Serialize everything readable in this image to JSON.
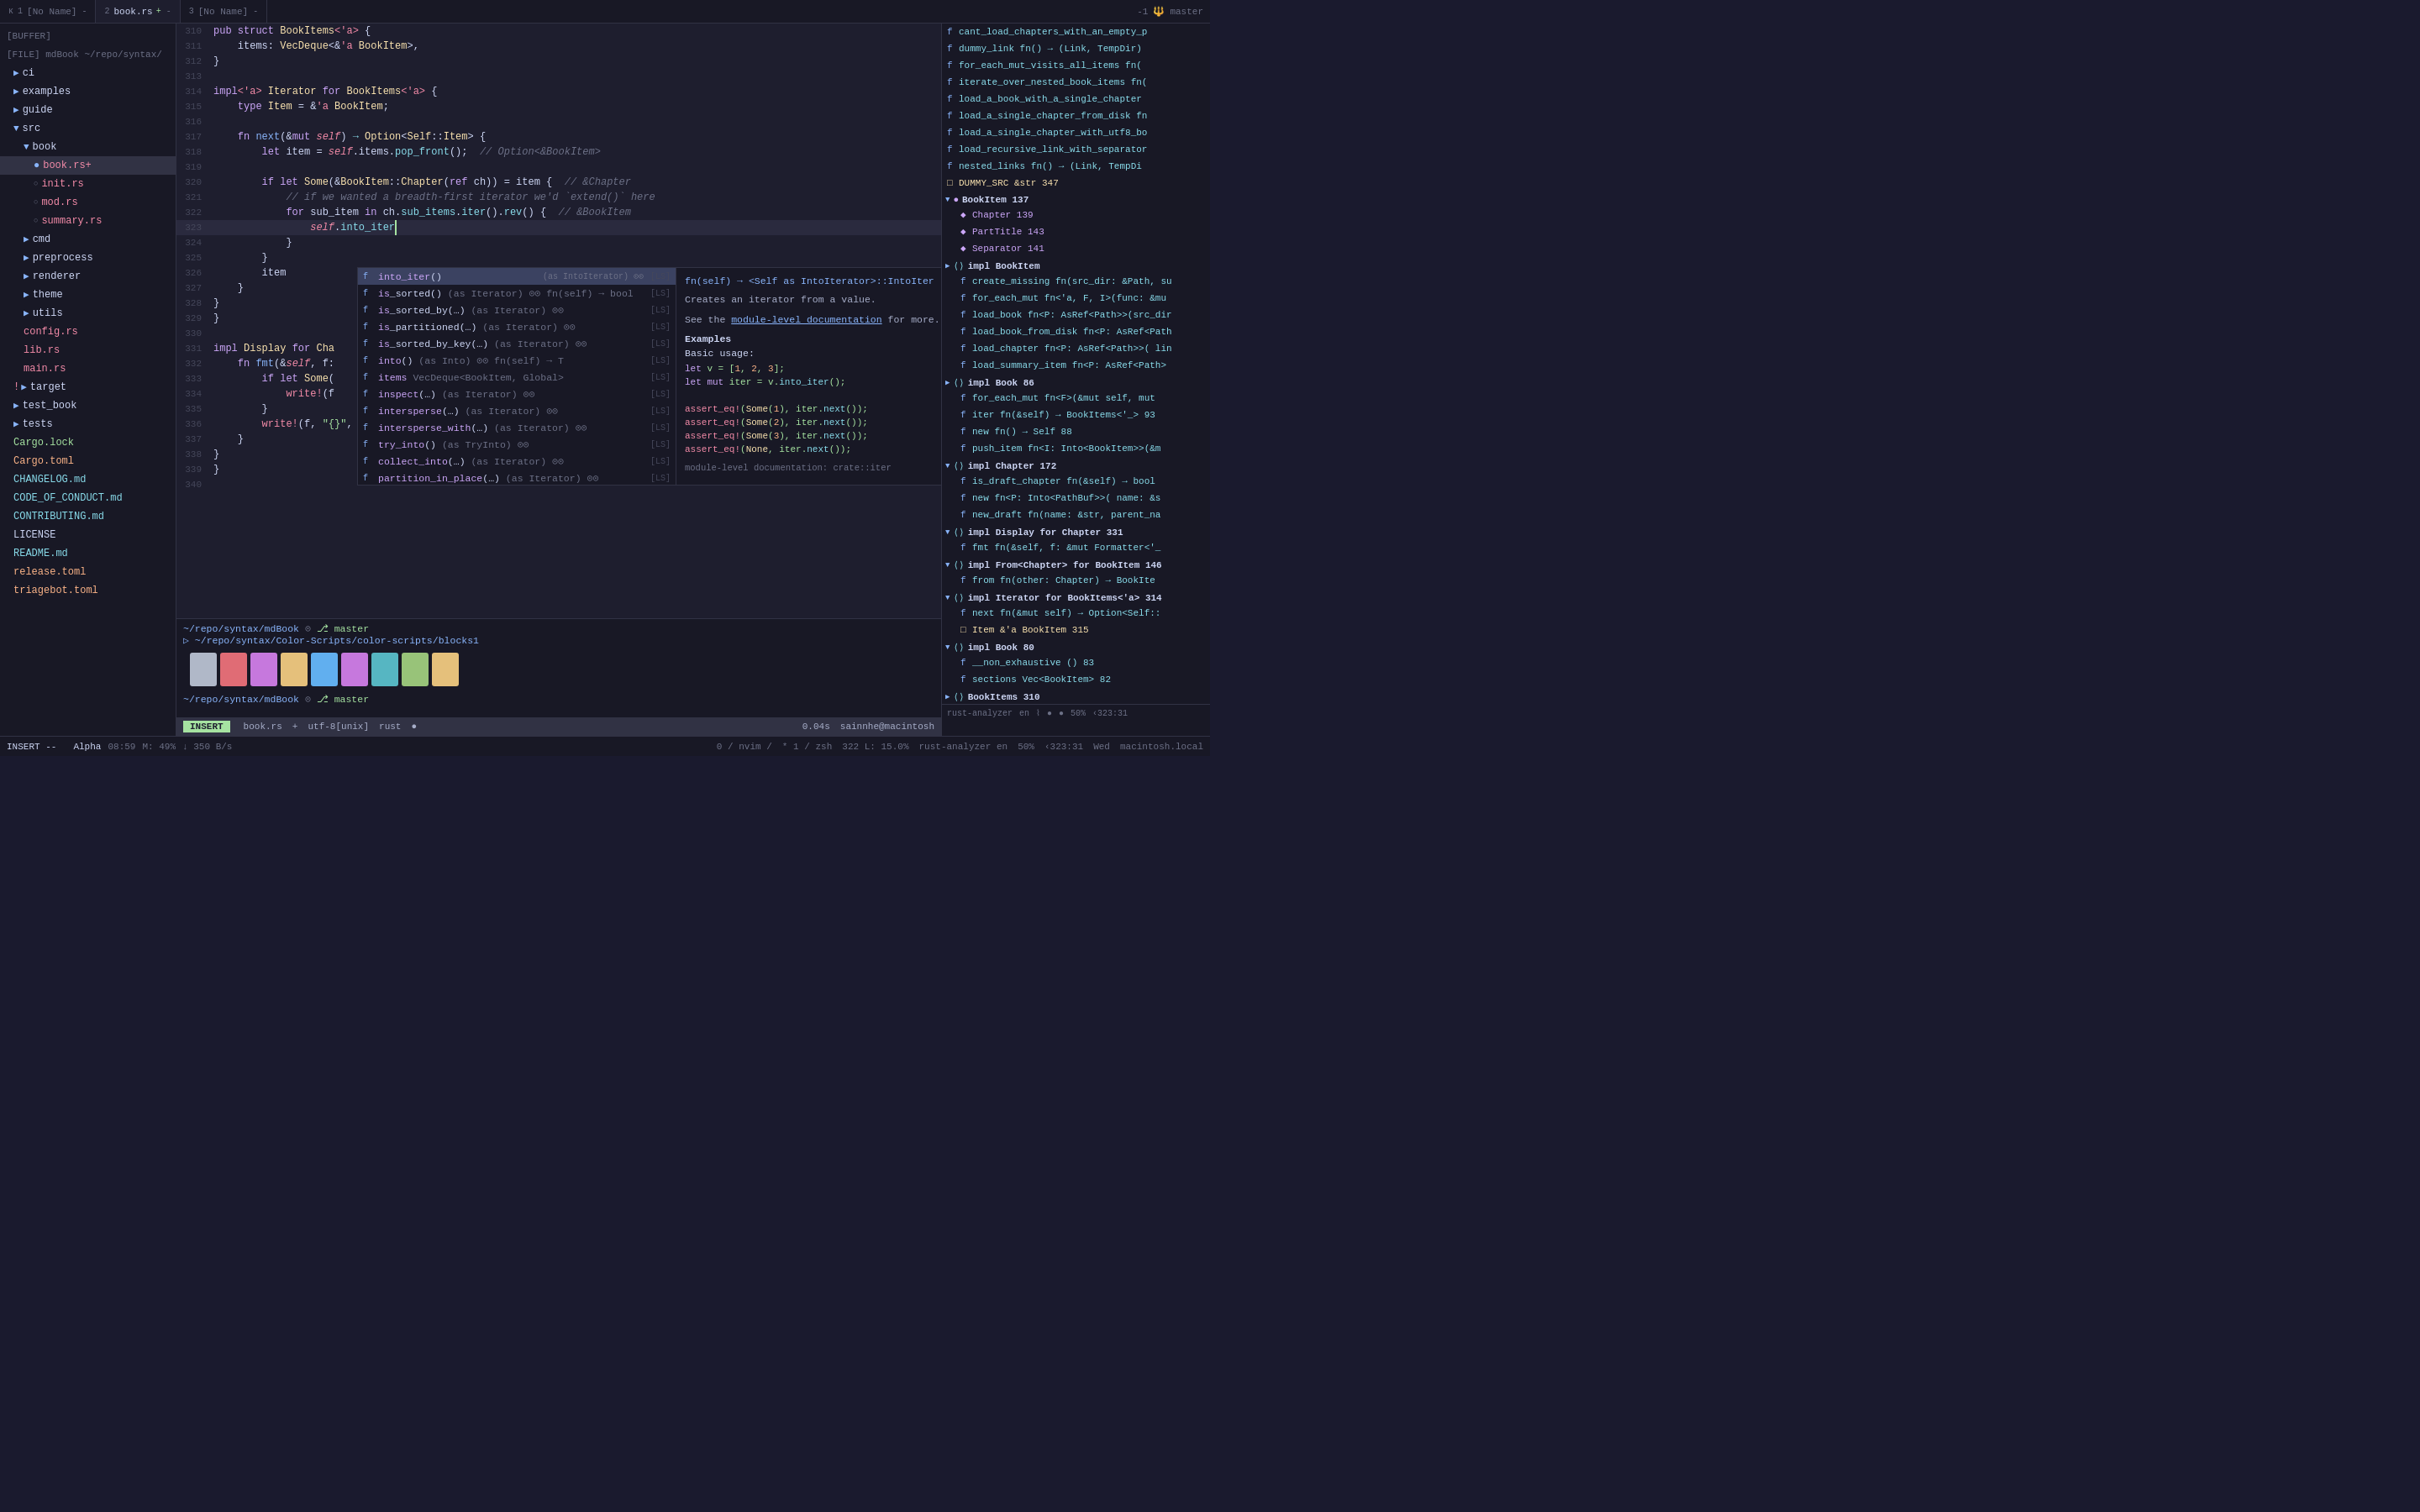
{
  "tabs": [
    {
      "id": 1,
      "label": "×",
      "name": "[No Name]",
      "active": false,
      "modified": false
    },
    {
      "id": 2,
      "label": "×",
      "name": "book.rs",
      "active": true,
      "modified": true
    },
    {
      "id": 3,
      "label": "×",
      "name": "[No Name]",
      "active": false,
      "modified": false
    }
  ],
  "sidebar": {
    "buffer_label": "[BUFFER]",
    "file_label": "[FILE] mdBook ~/repo/syntax/",
    "items": [
      {
        "name": "ci",
        "type": "folder",
        "indent": 1
      },
      {
        "name": "examples",
        "type": "folder",
        "indent": 1
      },
      {
        "name": "guide",
        "type": "folder",
        "indent": 1
      },
      {
        "name": "src",
        "type": "folder",
        "indent": 1,
        "open": true
      },
      {
        "name": "book",
        "type": "folder",
        "indent": 2,
        "open": true
      },
      {
        "name": "book.rs+",
        "type": "file-rs",
        "indent": 3,
        "active": true
      },
      {
        "name": "init.rs",
        "type": "file-rs",
        "indent": 3
      },
      {
        "name": "mod.rs",
        "type": "file-rs",
        "indent": 3
      },
      {
        "name": "summary.rs",
        "type": "file-rs",
        "indent": 3
      },
      {
        "name": "cmd",
        "type": "folder",
        "indent": 2
      },
      {
        "name": "preprocess",
        "type": "folder",
        "indent": 2
      },
      {
        "name": "renderer",
        "type": "folder",
        "indent": 2
      },
      {
        "name": "theme",
        "type": "folder",
        "indent": 2
      },
      {
        "name": "utils",
        "type": "folder",
        "indent": 2
      },
      {
        "name": "config.rs",
        "type": "file-rs",
        "indent": 2
      },
      {
        "name": "lib.rs",
        "type": "file-rs",
        "indent": 2
      },
      {
        "name": "main.rs",
        "type": "file-rs",
        "indent": 2
      },
      {
        "name": "target",
        "type": "folder",
        "indent": 1,
        "warn": true
      },
      {
        "name": "test_book",
        "type": "folder",
        "indent": 1
      },
      {
        "name": "tests",
        "type": "folder",
        "indent": 1
      },
      {
        "name": "Cargo.lock",
        "type": "file-lock",
        "indent": 1
      },
      {
        "name": "Cargo.toml",
        "type": "file-toml",
        "indent": 1
      },
      {
        "name": "CHANGELOG.md",
        "type": "file-md",
        "indent": 1
      },
      {
        "name": "CODE_OF_CONDUCT.md",
        "type": "file-md",
        "indent": 1
      },
      {
        "name": "CONTRIBUTING.md",
        "type": "file-md",
        "indent": 1
      },
      {
        "name": "LICENSE",
        "type": "file-default",
        "indent": 1
      },
      {
        "name": "README.md",
        "type": "file-md",
        "indent": 1
      },
      {
        "name": "release.toml",
        "type": "file-toml",
        "indent": 1
      },
      {
        "name": "triagebot.toml",
        "type": "file-toml",
        "indent": 1
      }
    ]
  },
  "code_lines": [
    {
      "num": 310,
      "content": "pub struct BookItems<'a> {"
    },
    {
      "num": 311,
      "content": "    items: VecDeque<&'a BookItem>,"
    },
    {
      "num": 312,
      "content": "}"
    },
    {
      "num": 313,
      "content": ""
    },
    {
      "num": 314,
      "content": "impl<'a> Iterator for BookItems<'a> {"
    },
    {
      "num": 315,
      "content": "    type Item = &'a BookItem;"
    },
    {
      "num": 316,
      "content": ""
    },
    {
      "num": 317,
      "content": "    fn next(&mut self) -> Option<Self::Item> {"
    },
    {
      "num": 318,
      "content": "        let item = self.items.pop_front();  // Option<&BookItem>"
    },
    {
      "num": 319,
      "content": ""
    },
    {
      "num": 320,
      "content": "        if let Some(&BookItem::Chapter(ref ch)) = item {  // &Chapter"
    },
    {
      "num": 321,
      "content": "            // if we wanted a breadth-first iterator we'd `extend()` here"
    },
    {
      "num": 322,
      "content": "            for sub_item in ch.sub_items.iter().rev() {  // &BookItem"
    },
    {
      "num": 323,
      "content": "                self.into_iter",
      "current": true
    },
    {
      "num": 324,
      "content": "            }"
    },
    {
      "num": 325,
      "content": "        }"
    },
    {
      "num": 326,
      "content": "        item"
    },
    {
      "num": 327,
      "content": "    }"
    },
    {
      "num": 328,
      "content": "}"
    },
    {
      "num": 329,
      "content": "}"
    },
    {
      "num": 330,
      "content": ""
    },
    {
      "num": 331,
      "content": "impl Display for Cha"
    },
    {
      "num": 332,
      "content": "    fn fmt(&self, f:"
    },
    {
      "num": 333,
      "content": "        if let Some("
    },
    {
      "num": 334,
      "content": "            write!(f"
    },
    {
      "num": 335,
      "content": "        }"
    },
    {
      "num": 336,
      "content": "        write!(f, \"{}\", self.name)"
    },
    {
      "num": 337,
      "content": "    }"
    },
    {
      "num": 338,
      "content": "}"
    },
    {
      "num": 339,
      "content": "}"
    },
    {
      "num": 340,
      "content": ""
    }
  ],
  "autocomplete": {
    "items": [
      {
        "name": "into_iter()",
        "detail": "(as IntoIterator) ⊙⊙",
        "kind": "f",
        "source": "[LS]",
        "selected": true
      },
      {
        "name": "is_sorted()",
        "detail": "(as Iterator) ⊙⊙ fn(self) → bool",
        "kind": "f",
        "source": "[LS]"
      },
      {
        "name": "is_sorted_by(…)",
        "detail": "(as Iterator) ⊙⊙",
        "kind": "f",
        "source": "[LS]"
      },
      {
        "name": "is_partitioned(…)",
        "detail": "(as Iterator) ⊙⊙",
        "kind": "f",
        "source": "[LS]"
      },
      {
        "name": "is_sorted_by_key(…)",
        "detail": "(as Iterator) ⊙⊙",
        "kind": "f",
        "source": "[LS]"
      },
      {
        "name": "into()",
        "detail": "(as Into) ⊙⊙ fn(self) → T",
        "kind": "f",
        "source": "[LS]"
      },
      {
        "name": "items",
        "detail": "VecDeque<BookItem, Global>",
        "kind": "f",
        "source": "[LS]"
      },
      {
        "name": "inspect(…)",
        "detail": "(as Iterator) ⊙⊙",
        "kind": "f",
        "source": "[LS]"
      },
      {
        "name": "intersperse(…)",
        "detail": "(as Iterator) ⊙⊙",
        "kind": "f",
        "source": "[LS]"
      },
      {
        "name": "intersperse_with(…)",
        "detail": "(as Iterator) ⊙⊙",
        "kind": "f",
        "source": "[LS]"
      },
      {
        "name": "try_into()",
        "detail": "(as TryInto) ⊙⊙",
        "kind": "f",
        "source": "[LS]"
      },
      {
        "name": "collect_into(…)",
        "detail": "(as Iterator) ⊙⊙",
        "kind": "f",
        "source": "[LS]"
      },
      {
        "name": "partition_in_place(…)",
        "detail": "(as Iterator) ⊙⊙",
        "kind": "f",
        "source": "[LS]"
      }
    ],
    "detail_sig": "fn(self) → <Self as IntoIterator>::IntoIter",
    "detail_desc": "Creates an iterator from a value.",
    "detail_link_text": "module-level documentation",
    "detail_link_url": "#",
    "detail_more_link": "See the module-level documentation for more.",
    "detail_examples_label": "Examples",
    "detail_basic_usage": "Basic usage:",
    "detail_code_lines": [
      "let v = [1, 2, 3];",
      "let mut iter = v.into_iter();",
      "",
      "assert_eq!(Some(1), iter.next());",
      "assert_eq!(Some(2), iter.next());",
      "assert_eq!(Some(3), iter.next());",
      "assert_eq!(None, iter.next());"
    ],
    "module_doc_link": "module-level documentation: crate::iter"
  },
  "right_panel": {
    "items": [
      {
        "type": "fn",
        "text": "cant_load_chapters_with_an_empty_p"
      },
      {
        "type": "fn",
        "text": "dummy_link fn() → (Link, TempDir)"
      },
      {
        "type": "fn",
        "text": "for_each_mut_visits_all_items fn("
      },
      {
        "type": "fn",
        "text": "iterate_over_nested_book_items fn("
      },
      {
        "type": "fn",
        "text": "load_a_book_with_a_single_chapter"
      },
      {
        "type": "fn",
        "text": "load_a_single_chapter_from_disk fn"
      },
      {
        "type": "fn",
        "text": "load_a_single_chapter_with_utf8_bo"
      },
      {
        "type": "fn",
        "text": "load_recursive_link_with_separator"
      },
      {
        "type": "fn",
        "text": "nested_links fn() → (Link, TempDi"
      },
      {
        "type": "const",
        "text": "DUMMY_SRC &str 347"
      }
    ],
    "sections": [
      {
        "label": "BookItem 137",
        "open": true,
        "children": [
          {
            "type": "struct",
            "text": "Chapter 139"
          },
          {
            "type": "struct",
            "text": "PartTitle 143"
          },
          {
            "type": "struct",
            "text": "Separator 141"
          }
        ]
      },
      {
        "label": "impl BookItem",
        "open": false,
        "children": [
          {
            "type": "fn",
            "text": "create_missing fn(src_dir: &Path, su"
          },
          {
            "type": "fn",
            "text": "for_each_mut fn<'a, F, I>(func: &mu"
          },
          {
            "type": "fn",
            "text": "load_book fn<P: AsRef<Path>>(src_dir"
          },
          {
            "type": "fn",
            "text": "load_book_from_disk fn<P: AsRef<Path"
          },
          {
            "type": "fn",
            "text": "load_chapter fn<P: AsRef<Path>>( lin"
          },
          {
            "type": "fn",
            "text": "load_summary_item fn<P: AsRef<Path>"
          }
        ]
      },
      {
        "label": "impl Book 86",
        "open": true,
        "children": [
          {
            "type": "fn",
            "text": "for_each_mut fn<F>(&mut self, mut"
          },
          {
            "type": "fn",
            "text": "iter fn(&self) → BookItems<'_> 93"
          },
          {
            "type": "fn",
            "text": "new fn() → Self 88"
          },
          {
            "type": "fn",
            "text": "push_item fn<I: Into<BookItem>>(&m"
          }
        ]
      },
      {
        "label": "impl Chapter 172",
        "open": true,
        "children": [
          {
            "type": "fn",
            "text": "is_draft_chapter fn(&self) → bool"
          },
          {
            "type": "fn",
            "text": "new fn<P: Into<PathBuf>>( name: &s"
          },
          {
            "type": "fn",
            "text": "new_draft fn(name: &str, parent_na"
          }
        ]
      },
      {
        "label": "impl Display for Chapter 331",
        "open": false,
        "children": [
          {
            "type": "fn",
            "text": "fmt fn(&self, f: &mut Formatter<'_"
          }
        ]
      },
      {
        "label": "impl From<Chapter> for BookItem 146",
        "open": false,
        "children": [
          {
            "type": "fn",
            "text": "from fn(other: Chapter) → BookIte"
          }
        ]
      },
      {
        "label": "impl Iterator for BookItems<'a> 314",
        "open": true,
        "children": [
          {
            "type": "fn",
            "text": "next fn(&mut self) → Option<Self::"
          },
          {
            "type": "const",
            "text": "Item &'a BookItem 315"
          }
        ]
      },
      {
        "label": "impl Book 80",
        "open": true,
        "children": [
          {
            "type": "fn",
            "text": "__non_exhaustive () 83"
          },
          {
            "type": "fn",
            "text": "sections Vec<BookItem> 82"
          }
        ]
      },
      {
        "label": "BookItems 310",
        "open": false,
        "children": []
      }
    ]
  },
  "terminal": {
    "path1": "~/repo/syntax/mdBook",
    "branch1": "master",
    "path2": "~/repo/syntax/Color-Scripts/color-scripts/blocks1",
    "branch2": "master",
    "command2": ""
  },
  "swatches": [
    "#b0b8c8",
    "#e06c75",
    "#c678dd",
    "#e5c07b",
    "#61afef",
    "#c678dd",
    "#56b6c2",
    "#98c379",
    "#e5c07b"
  ],
  "status_bar": {
    "mode": "INSERT",
    "file": "book.rs",
    "modified": "+",
    "encoding": "utf-8[unix]",
    "filetype": "rust",
    "dot": "●",
    "position": "0.04s",
    "user": "sainnhe@macintosh"
  },
  "bottom_bar": {
    "mode_label": "INSERT --",
    "items": [
      "Alpha",
      "08:59",
      "M: 49%",
      "↓ 350 B/s"
    ],
    "right_items": [
      "0 / nvim /",
      "* 1 / zsh"
    ],
    "position": "322 L: 15.0%",
    "encoding": "rust-analyzer en",
    "zoom": "50%",
    "cursor": "‹323:31",
    "date": "Wed",
    "host": "macintosh.local"
  }
}
